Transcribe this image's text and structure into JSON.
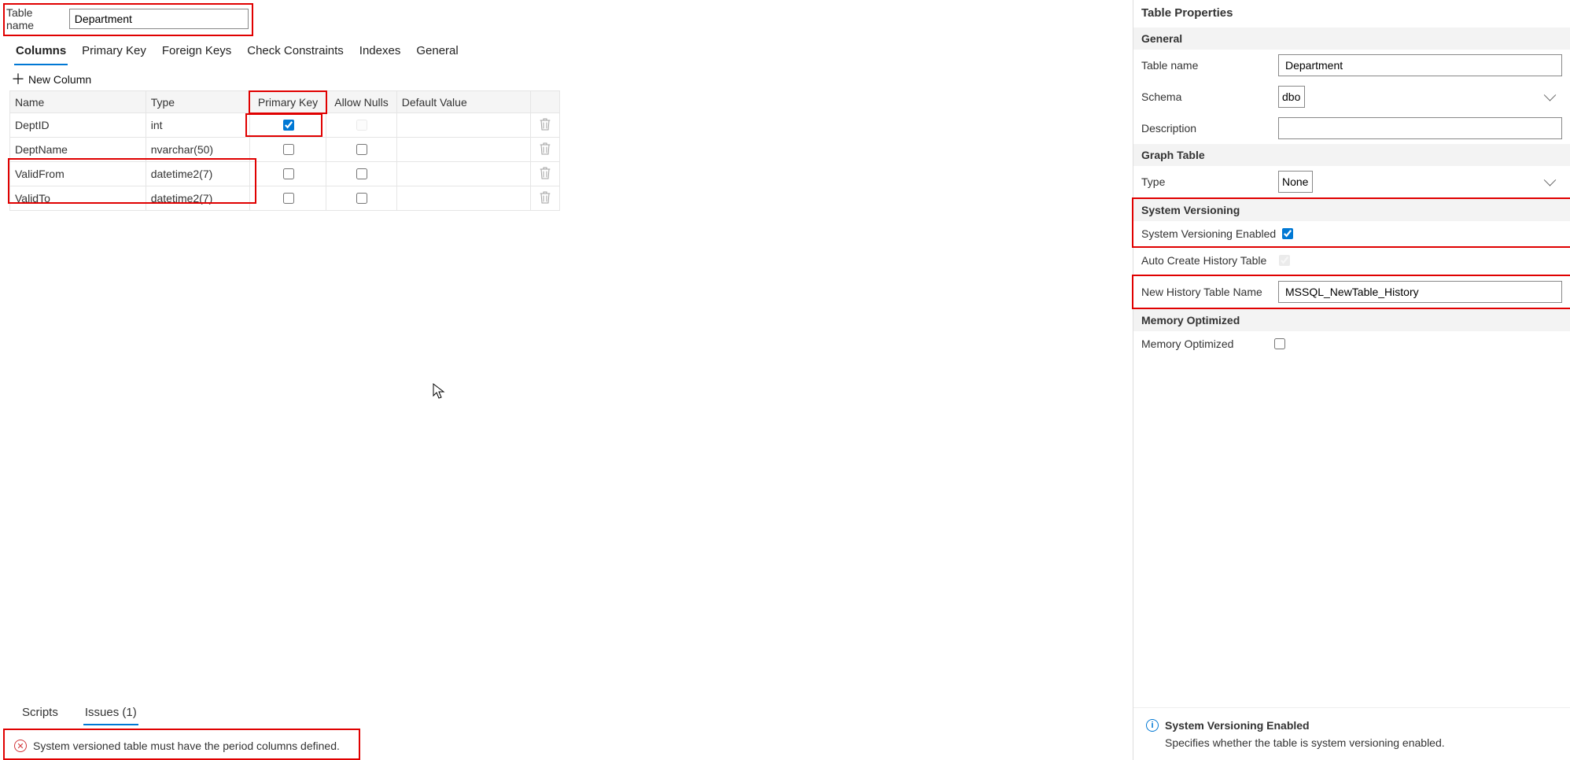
{
  "header": {
    "table_name_label": "Table name",
    "table_name_value": "Department"
  },
  "tabs": {
    "columns": "Columns",
    "primary_key": "Primary Key",
    "foreign_keys": "Foreign Keys",
    "check_constraints": "Check Constraints",
    "indexes": "Indexes",
    "general": "General"
  },
  "toolbar": {
    "new_column": "New Column"
  },
  "grid": {
    "headers": {
      "name": "Name",
      "type": "Type",
      "pk": "Primary Key",
      "allow_nulls": "Allow Nulls",
      "default_value": "Default Value"
    },
    "rows": [
      {
        "name": "DeptID",
        "type": "int",
        "pk": true,
        "allow_nulls": false,
        "allow_nulls_disabled": true,
        "default_value": ""
      },
      {
        "name": "DeptName",
        "type": "nvarchar(50)",
        "pk": false,
        "allow_nulls": false,
        "allow_nulls_disabled": false,
        "default_value": ""
      },
      {
        "name": "ValidFrom",
        "type": "datetime2(7)",
        "pk": false,
        "allow_nulls": false,
        "allow_nulls_disabled": false,
        "default_value": ""
      },
      {
        "name": "ValidTo",
        "type": "datetime2(7)",
        "pk": false,
        "allow_nulls": false,
        "allow_nulls_disabled": false,
        "default_value": ""
      }
    ]
  },
  "bottom": {
    "tabs": {
      "scripts": "Scripts",
      "issues": "Issues (1)"
    },
    "issue_text": "System versioned table must have the period columns defined."
  },
  "props": {
    "title": "Table Properties",
    "sections": {
      "general": "General",
      "graph_table": "Graph Table",
      "system_versioning": "System Versioning",
      "memory_optimized": "Memory Optimized"
    },
    "labels": {
      "table_name": "Table name",
      "schema": "Schema",
      "description": "Description",
      "type": "Type",
      "sv_enabled": "System Versioning Enabled",
      "auto_create_history": "Auto Create History Table",
      "new_history_table_name": "New History Table Name",
      "memory_optimized": "Memory Optimized"
    },
    "values": {
      "table_name": "Department",
      "schema": "dbo",
      "description": "",
      "type": "None",
      "sv_enabled": true,
      "auto_create_history": true,
      "new_history_table_name": "MSSQL_NewTable_History",
      "memory_optimized": false
    }
  },
  "help": {
    "title": "System Versioning Enabled",
    "body": "Specifies whether the table is system versioning enabled."
  }
}
